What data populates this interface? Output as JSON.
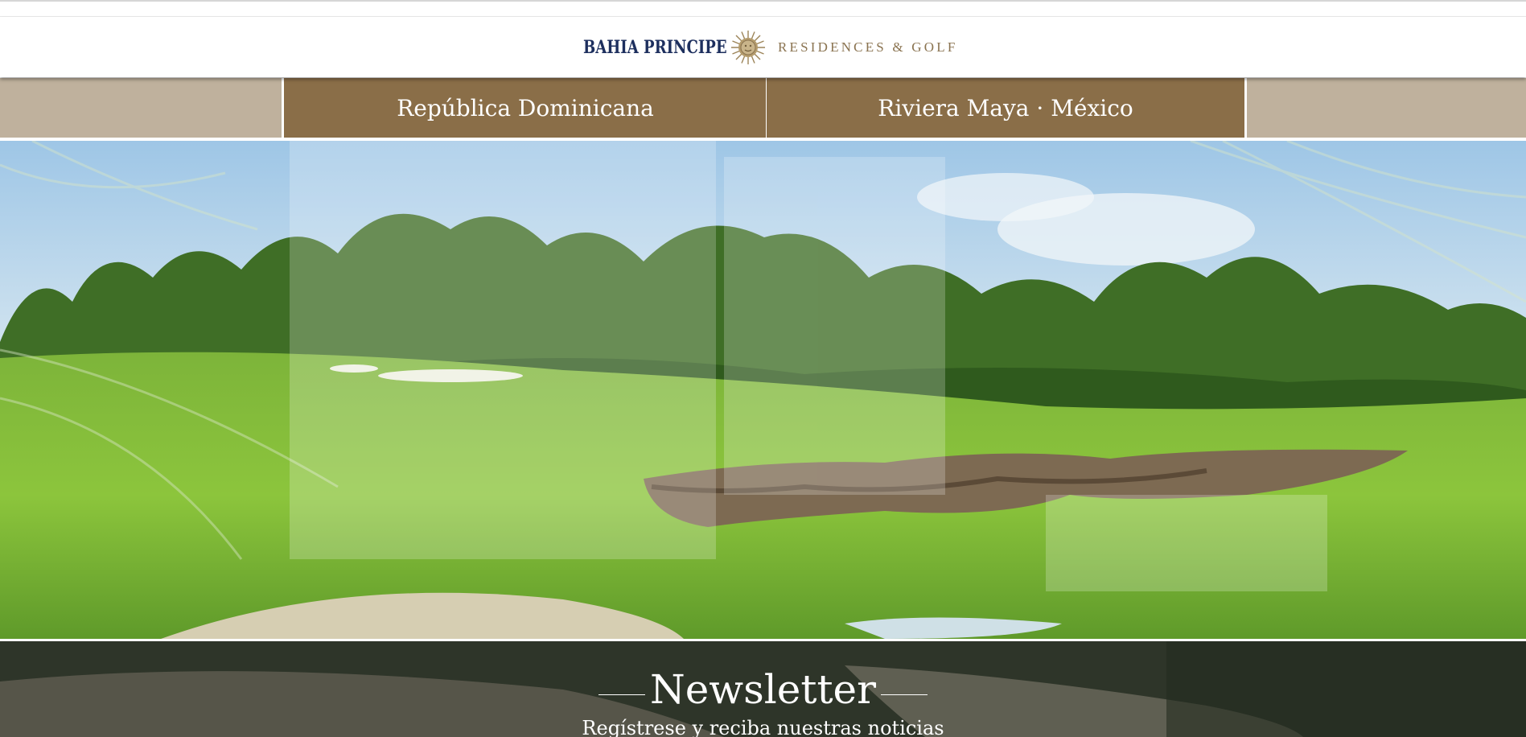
{
  "brand": {
    "name": "BAHIA PRINCIPE",
    "tagline": "RESIDENCES & GOLF",
    "logo_icon": "sun-emblem-icon",
    "colors": {
      "navy": "#1d2f5e",
      "gold": "#8a7350"
    }
  },
  "nav": {
    "tabs": [
      {
        "label": "República Dominicana"
      },
      {
        "label": "Riviera Maya · México"
      }
    ],
    "colors": {
      "tab_bg": "#8a6e48",
      "bar_bg": "#bfb19d"
    }
  },
  "hero": {
    "image": "golf-course-hero-image"
  },
  "newsletter": {
    "title": "Newsletter",
    "subtitle": "Regístrese y reciba nuestras noticias"
  }
}
